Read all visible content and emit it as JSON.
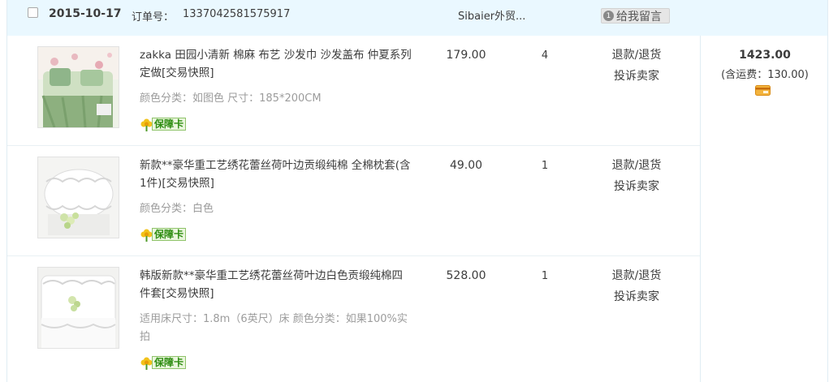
{
  "order": {
    "date": "2015-10-17",
    "order_no_label": "订单号：",
    "order_no": "1337042581575917",
    "shop_name": "Sibaier外贸...",
    "message_badge": "1",
    "message_button": "给我留言"
  },
  "items": [
    {
      "name": "zakka 田园小清新 棉麻 布艺 沙发巾 沙发盖布 仲夏系列 定做[交易快照]",
      "attributes": "颜色分类：如图色  尺寸：185*200CM",
      "badge": "保障卡",
      "price": "179.00",
      "quantity": "4",
      "op_refund": "退款/退货",
      "op_complain": "投诉卖家"
    },
    {
      "name": "新款**豪华重工艺绣花蕾丝荷叶边贡缎纯棉 全棉枕套(含1件)[交易快照]",
      "attributes": "颜色分类：白色",
      "badge": "保障卡",
      "price": "49.00",
      "quantity": "1",
      "op_refund": "退款/退货",
      "op_complain": "投诉卖家"
    },
    {
      "name": "韩版新款**豪华重工艺绣花蕾丝荷叶边白色贡缎纯棉四件套[交易快照]",
      "attributes": "适用床尺寸：1.8m（6英尺）床  颜色分类：如果100%实拍",
      "badge": "保障卡",
      "price": "528.00",
      "quantity": "1",
      "op_refund": "退款/退货",
      "op_complain": "投诉卖家"
    }
  ],
  "summary": {
    "total": "1423.00",
    "shipping": "(含运费：130.00)"
  }
}
